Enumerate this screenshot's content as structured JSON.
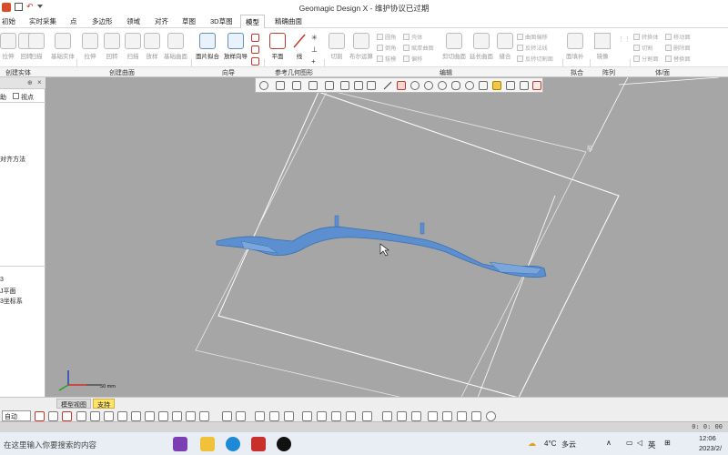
{
  "window": {
    "title": "Geomagic Design X - 维护协议已过期"
  },
  "menu": {
    "items": [
      "初始",
      "实时采集",
      "点",
      "多边形",
      "领域",
      "对齐",
      "草图",
      "3D草图",
      "模型",
      "精确曲面"
    ],
    "active": "模型"
  },
  "ribbon": {
    "solid_buttons": [
      "拉伸",
      "回转",
      "扫描",
      "放样",
      "基础实体"
    ],
    "surface_buttons": [
      "拉伸",
      "回转",
      "扫描",
      "放样",
      "基础曲面"
    ],
    "wizard_buttons": [
      "面片拟合",
      "放样向导"
    ],
    "ref_buttons": [
      "平面",
      "线"
    ],
    "edit_big_buttons": [
      "切割",
      "布尔运算"
    ],
    "edit_small_col1": [
      "圆角",
      "倒角",
      "拔模"
    ],
    "edit_small_col2": [
      "壳体",
      "赋厚曲面",
      "偏移"
    ],
    "edit_more_buttons": [
      "剪切曲面",
      "延长曲面",
      "缝合"
    ],
    "edit_small_col3": [
      "曲面偏移",
      "反转法线",
      "反转切割面"
    ],
    "fit_button": "面填补",
    "array_button": "镜像",
    "body_small": [
      "转换体",
      "切割",
      "分割面"
    ],
    "body_small2": [
      "移动面",
      "删除面",
      "替换面"
    ],
    "groups": [
      "创建实体",
      "创建曲面",
      "向导",
      "参考几何图形",
      "编辑",
      "拟合",
      "阵列",
      "体/面"
    ]
  },
  "left_panel": {
    "tabs": [
      "助",
      "视点"
    ],
    "text_align": "对齐方法",
    "tree": [
      "3",
      "J平面",
      "3坐标系"
    ]
  },
  "viewport": {
    "scale_label": "50 mm",
    "plane_label": "前"
  },
  "bottom": {
    "tabs": [
      "模型视图",
      "支持"
    ],
    "mode_select": "自动"
  },
  "status": {
    "coords": "0: 0: 00"
  },
  "taskbar": {
    "search_placeholder": "在这里输入你要搜索的内容",
    "weather_temp": "4°C",
    "weather_desc": "多云",
    "lang": "英",
    "time": "12:06",
    "date": "2023/2/"
  },
  "colors": {
    "viewport_bg": "#a6a6a6",
    "model_blue": "#5b8fd0",
    "bottom_tab_highlight": "#ffe36b",
    "taskbar_bg": "#e9eef4"
  }
}
